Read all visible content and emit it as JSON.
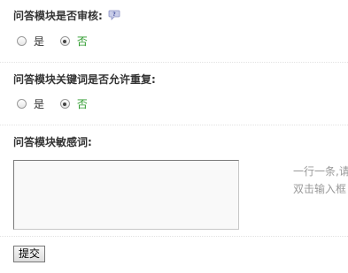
{
  "review": {
    "label": "问答模块是否审核:",
    "options": [
      {
        "label": "是",
        "checked": false
      },
      {
        "label": "否",
        "checked": true
      }
    ]
  },
  "duplicate": {
    "label": "问答模块关键词是否允许重复:",
    "options": [
      {
        "label": "是",
        "checked": false
      },
      {
        "label": "否",
        "checked": true
      }
    ]
  },
  "sensitive": {
    "label": "问答模块敏感词:",
    "value": "",
    "hint_line1": "一行一条,请",
    "hint_line2": "双击输入框"
  },
  "submit_label": "提交",
  "colors": {
    "selected_option": "#2a9a2a",
    "hint": "#999999"
  },
  "icons": {
    "help": "speech-bubble-help-icon"
  }
}
